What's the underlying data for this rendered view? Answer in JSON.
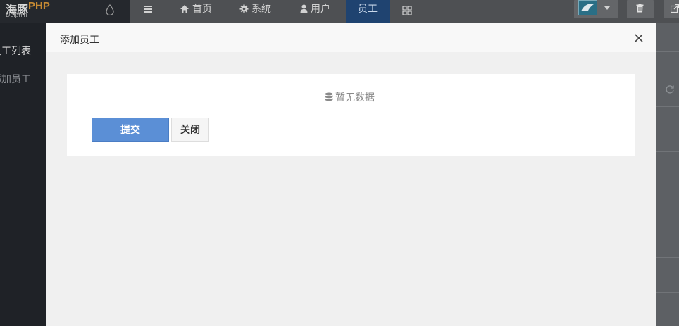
{
  "brand": {
    "name_zh": "海豚",
    "name_php": "PHP",
    "name_en": "Dolphin"
  },
  "sidebar": {
    "items": [
      {
        "label": "员工列表"
      },
      {
        "label": "添加员工"
      }
    ]
  },
  "topnav": {
    "items": [
      {
        "label": "首页",
        "icon": "home-icon"
      },
      {
        "label": "系统",
        "icon": "gear-icon"
      },
      {
        "label": "用户",
        "icon": "user-icon"
      },
      {
        "label": "员工",
        "icon": ""
      }
    ],
    "active": "员工"
  },
  "modal": {
    "title": "添加员工",
    "empty_text": "暂无数据",
    "submit_label": "提交",
    "close_label": "关闭"
  },
  "colors": {
    "submit": "#5b8fd6",
    "nav_active": "#1f4370",
    "brand_php": "#c68a33"
  }
}
